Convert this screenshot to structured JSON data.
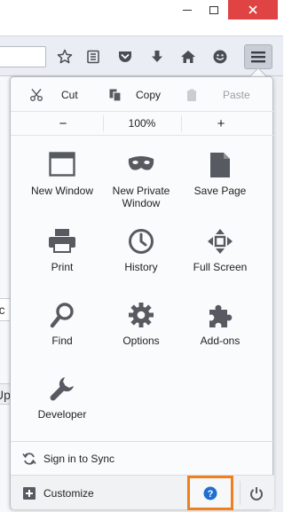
{
  "panel": {
    "edit": {
      "cut_label": "Cut",
      "copy_label": "Copy",
      "paste_label": "Paste"
    },
    "zoom": {
      "minus_label": "−",
      "level": "100%",
      "plus_label": "+"
    },
    "grid": [
      {
        "label": "New Window",
        "icon": "new-window-icon"
      },
      {
        "label": "New Private Window",
        "icon": "private-mask-icon"
      },
      {
        "label": "Save Page",
        "icon": "save-page-icon"
      },
      {
        "label": "Print",
        "icon": "printer-icon"
      },
      {
        "label": "History",
        "icon": "clock-icon"
      },
      {
        "label": "Full Screen",
        "icon": "fullscreen-icon"
      },
      {
        "label": "Find",
        "icon": "magnifier-icon"
      },
      {
        "label": "Options",
        "icon": "gear-icon"
      },
      {
        "label": "Add-ons",
        "icon": "puzzle-icon"
      },
      {
        "label": "Developer",
        "icon": "wrench-icon"
      }
    ],
    "sync_label": "Sign in to Sync",
    "customize_label": "Customize"
  },
  "page_peek": {
    "line1": "rc",
    "line2": "Up"
  },
  "colors": {
    "highlight": "#f07f1d",
    "help_blue": "#1f6fd0",
    "icon_gray": "#575b61",
    "close_red": "#e04343"
  }
}
